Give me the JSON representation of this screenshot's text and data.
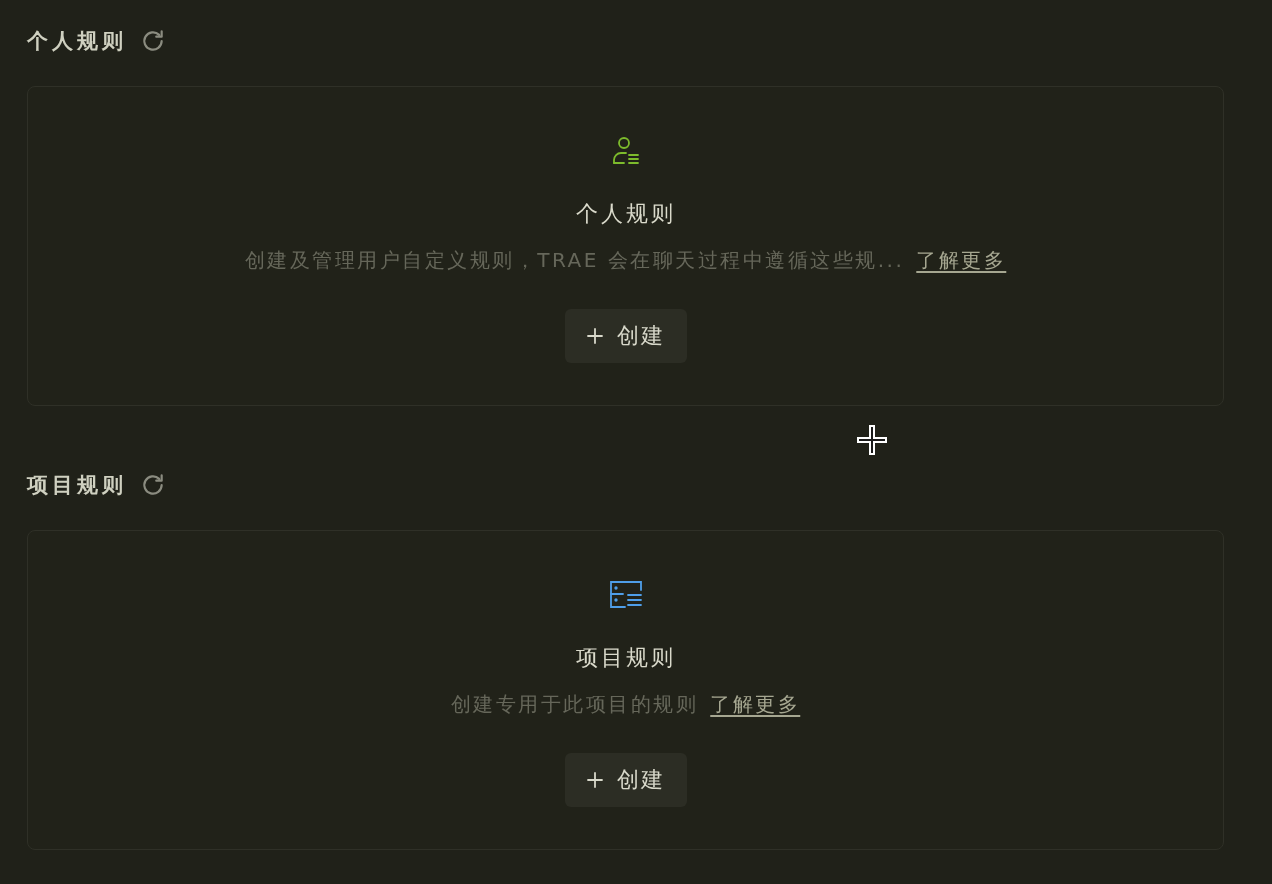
{
  "sections": [
    {
      "heading": "个人规则",
      "card": {
        "kind": "user",
        "title": "个人规则",
        "description": "创建及管理用户自定义规则，TRAE 会在聊天过程中遵循这些规...",
        "link": "了解更多",
        "button": "创建"
      }
    },
    {
      "heading": "项目规则",
      "card": {
        "kind": "project",
        "title": "项目规则",
        "description": "创建专用于此项目的规则",
        "link": "了解更多",
        "button": "创建"
      }
    }
  ]
}
